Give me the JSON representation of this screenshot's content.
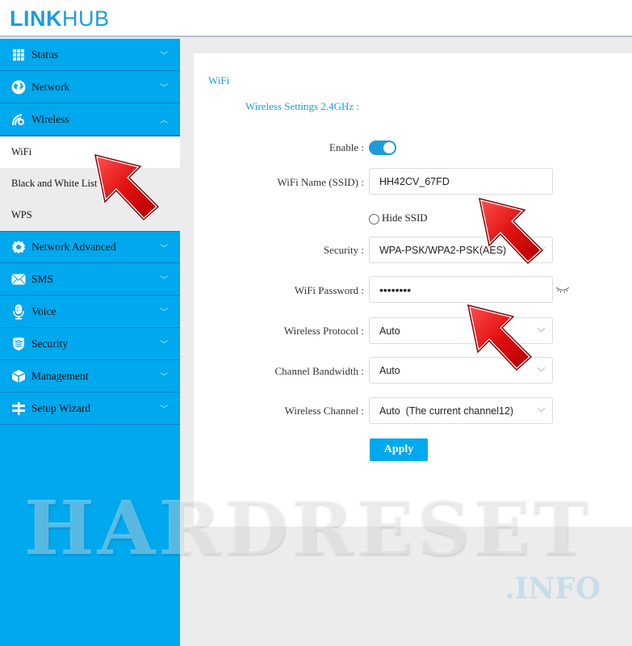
{
  "header": {
    "logo_bold": "LINK",
    "logo_thin": "HUB"
  },
  "sidebar": {
    "items": [
      {
        "label": "Status",
        "icon": "grid-icon",
        "expanded": false
      },
      {
        "label": "Network",
        "icon": "globe-icon",
        "expanded": false
      },
      {
        "label": "Wireless",
        "icon": "wireless-icon",
        "expanded": true,
        "children": [
          {
            "label": "WiFi",
            "active": true
          },
          {
            "label": "Black and White List",
            "active": false
          },
          {
            "label": "WPS",
            "active": false
          }
        ]
      },
      {
        "label": "Network Advanced",
        "icon": "gear-icon",
        "expanded": false
      },
      {
        "label": "SMS",
        "icon": "envelope-icon",
        "expanded": false
      },
      {
        "label": "Voice",
        "icon": "microphone-icon",
        "expanded": false
      },
      {
        "label": "Security",
        "icon": "shield-icon",
        "expanded": false
      },
      {
        "label": "Management",
        "icon": "cube-icon",
        "expanded": false
      },
      {
        "label": "Setup Wizard",
        "icon": "signpost-icon",
        "expanded": false
      }
    ]
  },
  "main": {
    "section_title": "WiFi",
    "sub_title": "Wireless Settings 2.4GHz :",
    "form": {
      "enable": {
        "label": "Enable :",
        "value": true
      },
      "ssid": {
        "label": "WiFi Name (SSID) :",
        "value": "HH42CV_67FD"
      },
      "hide_ssid": {
        "label": "Hide SSID",
        "checked": false
      },
      "security": {
        "label": "Security :",
        "value": "WPA-PSK/WPA2-PSK(AES)"
      },
      "password": {
        "label": "WiFi Password :",
        "value": "••••••••"
      },
      "protocol": {
        "label": "Wireless Protocol :",
        "value": "Auto"
      },
      "bandwidth": {
        "label": "Channel Bandwidth :",
        "value": "Auto"
      },
      "channel": {
        "label": "Wireless Channel :",
        "value": "Auto  (The current channel12)"
      }
    },
    "apply_label": "Apply"
  },
  "watermark": {
    "main": "HARDRESET",
    "sub": ".INFO"
  },
  "colors": {
    "accent": "#00a8ee",
    "link": "#1e9cd7",
    "annotation_arrow": "#d40000"
  }
}
